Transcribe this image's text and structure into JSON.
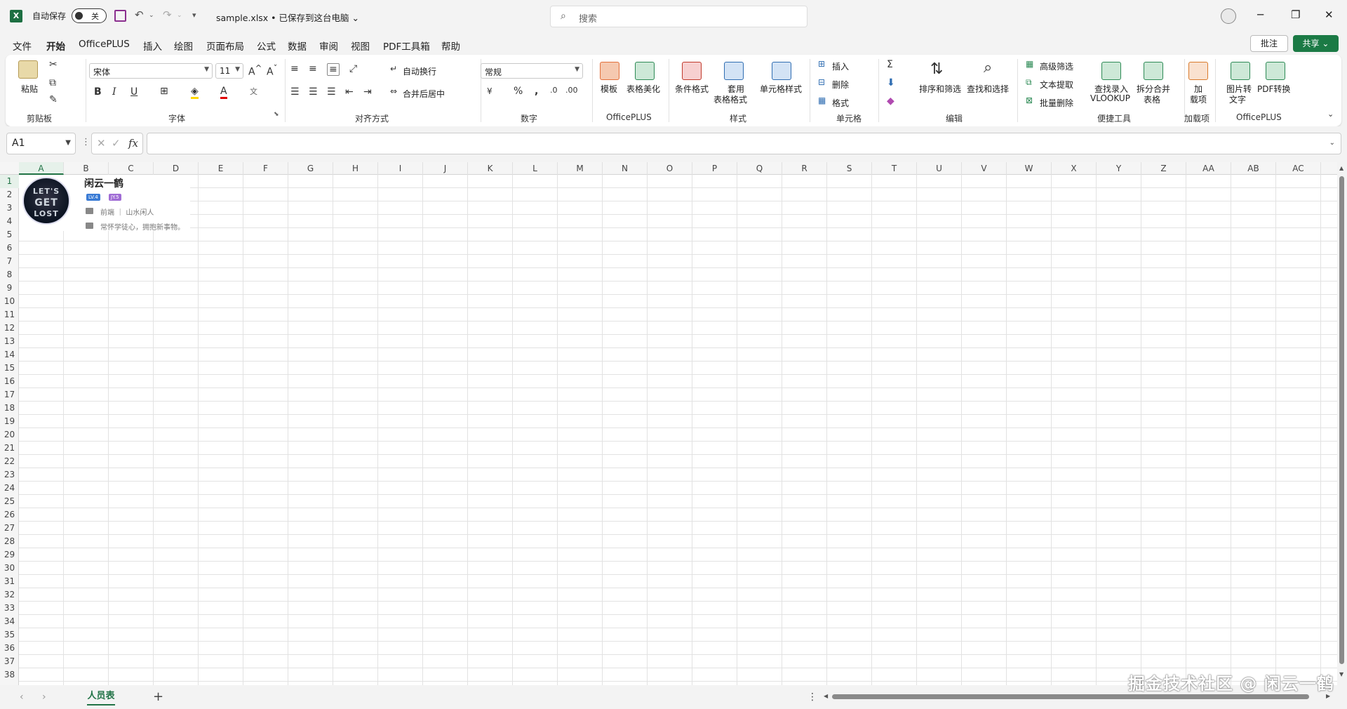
{
  "titlebar": {
    "autosave_label": "自动保存",
    "autosave_state": "关",
    "filename": "sample.xlsx • 已保存到这台电脑 ⌄",
    "search_placeholder": "搜索",
    "window_controls": [
      "─",
      "❐",
      "✕"
    ]
  },
  "menu_tabs": [
    "文件",
    "开始",
    "OfficePLUS",
    "插入",
    "绘图",
    "页面布局",
    "公式",
    "数据",
    "审阅",
    "视图",
    "PDF工具箱",
    "帮助"
  ],
  "active_tab": "开始",
  "comment_button": "批注",
  "share_button": "共享",
  "ribbon": {
    "clipboard": {
      "paste": "粘贴",
      "label": "剪贴板"
    },
    "font": {
      "name": "宋体",
      "size": "11",
      "label": "字体"
    },
    "alignment": {
      "wrap": "自动换行",
      "merge": "合并后居中",
      "label": "对齐方式"
    },
    "number": {
      "format": "常规",
      "label": "数字"
    },
    "officeplus": {
      "template": "模板",
      "beautify": "表格美化",
      "label": "OfficePLUS"
    },
    "styles": {
      "conditional": "条件格式",
      "table_format_1": "套用",
      "table_format_2": "表格格式",
      "cell_styles": "单元格样式",
      "label": "样式"
    },
    "cells": {
      "insert": "插入",
      "delete": "删除",
      "format": "格式",
      "label": "单元格"
    },
    "editing": {
      "sort_filter": "排序和筛选",
      "find_select": "查找和选择",
      "label": "编辑"
    },
    "tools": {
      "advanced_filter": "高级筛选",
      "text_extract": "文本提取",
      "batch_delete": "批量删除",
      "vlookup_1": "查找录入",
      "vlookup_2": "VLOOKUP",
      "split_1": "拆分合并",
      "split_2": "表格",
      "label": "便捷工具"
    },
    "addins": {
      "label_1": "加",
      "label_2": "载项",
      "label": "加载项"
    },
    "officeplus2": {
      "img_text_1": "图片转",
      "img_text_2": "文字",
      "pdf": "PDF转换",
      "label": "OfficePLUS"
    }
  },
  "formula_bar": {
    "name_box": "A1",
    "fx": "fx",
    "value": ""
  },
  "columns": [
    "A",
    "B",
    "C",
    "D",
    "E",
    "F",
    "G",
    "H",
    "I",
    "J",
    "K",
    "L",
    "M",
    "N",
    "O",
    "P",
    "Q",
    "R",
    "S",
    "T",
    "U",
    "V",
    "W",
    "X",
    "Y",
    "Z",
    "AA",
    "AB",
    "AC"
  ],
  "rows": [
    "1",
    "2",
    "3",
    "4",
    "5",
    "6",
    "7",
    "8",
    "9",
    "10",
    "11",
    "12",
    "13",
    "14",
    "15",
    "16",
    "17",
    "18",
    "19",
    "20",
    "21",
    "22",
    "23",
    "24",
    "25",
    "26",
    "27",
    "28",
    "29",
    "30",
    "31",
    "32",
    "33",
    "34",
    "35",
    "36",
    "37",
    "38"
  ],
  "card": {
    "avatar_text": [
      "LET'S",
      "GET",
      "LOST"
    ],
    "name": "闲云一鹤",
    "badge_1": "LV.4",
    "badge_2": "JY.5",
    "job": "前端 ｜ 山水闲人",
    "motto": "常怀学徒心，拥抱新事物。"
  },
  "sheet_tabs": [
    "人员表"
  ],
  "watermark": "掘金技术社区 @ 闲云一鹤",
  "colors": {
    "accent": "#217346",
    "share": "#1b7a45"
  }
}
